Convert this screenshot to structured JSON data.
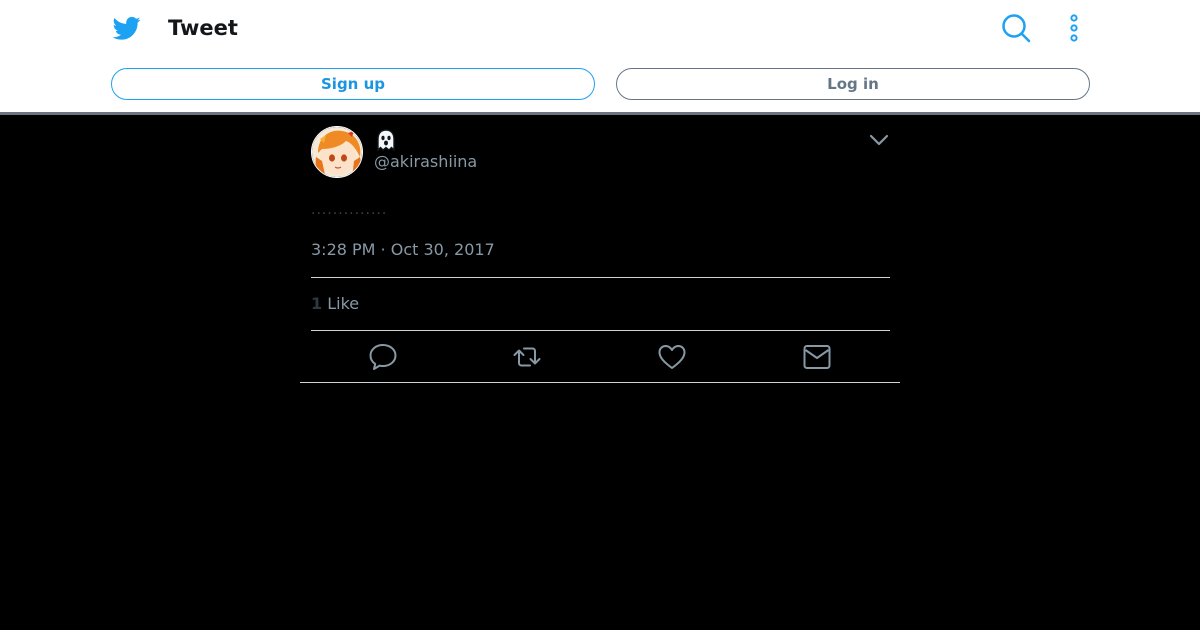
{
  "header": {
    "title": "Tweet",
    "icons": [
      "twitter-bird-icon",
      "search-icon",
      "more-vertical-icon"
    ],
    "signup_label": "Sign up",
    "login_label": "Log in"
  },
  "tweet": {
    "display_name_emoji": "ghost",
    "handle": "@akirashiina",
    "text": "..............",
    "timestamp": "3:28 PM · Oct 30, 2017",
    "like_count": "1",
    "like_label": "Like",
    "actions": [
      "reply-icon",
      "retweet-icon",
      "like-icon",
      "direct-message-icon"
    ]
  },
  "colors": {
    "accent": "#1da1f2",
    "background": "#000000",
    "muted_text": "#8899a6",
    "header_bg": "#ffffff"
  }
}
